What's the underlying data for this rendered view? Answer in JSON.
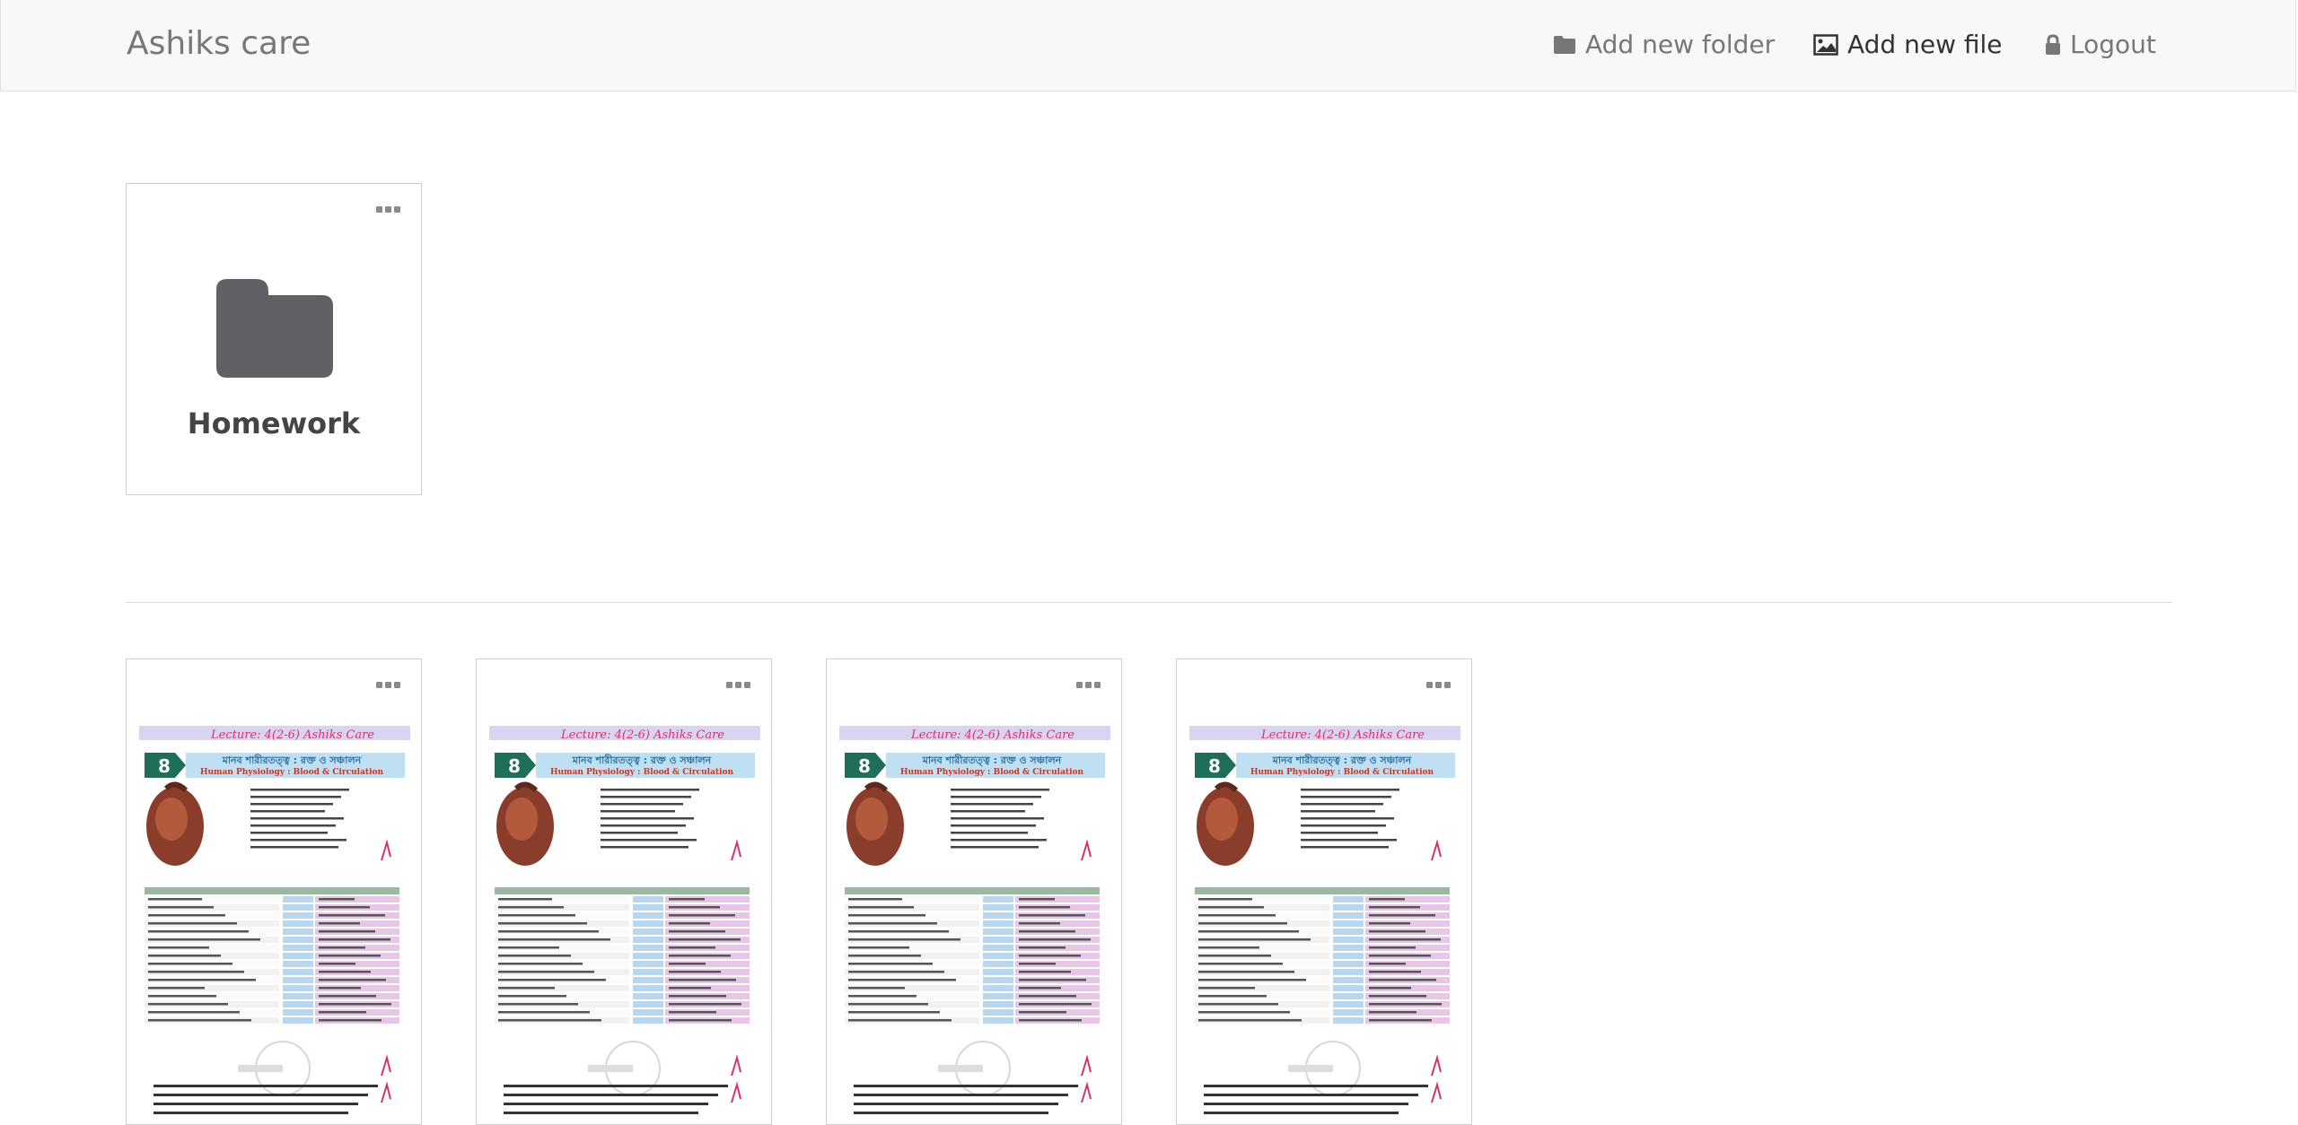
{
  "navbar": {
    "brand": "Ashiks care",
    "add_folder_label": "Add new folder",
    "add_file_label": "Add new file",
    "logout_label": "Logout"
  },
  "folders": [
    {
      "name": "Homework"
    }
  ],
  "files": [
    {
      "thumb_header": "Lecture: 4(2-6) Ashiks Care",
      "chapter_no": "8",
      "title_bn": "মানব শারীরতত্ত্ব : রক্ত ও সঞ্চালন",
      "title_en": "Human Physiology : Blood & Circulation"
    },
    {
      "thumb_header": "Lecture: 4(2-6) Ashiks Care",
      "chapter_no": "8",
      "title_bn": "মানব শারীরতত্ত্ব : রক্ত ও সঞ্চালন",
      "title_en": "Human Physiology : Blood & Circulation"
    },
    {
      "thumb_header": "Lecture: 4(2-6) Ashiks Care",
      "chapter_no": "8",
      "title_bn": "মানব শারীরতত্ত্ব : রক্ত ও সঞ্চালন",
      "title_en": "Human Physiology : Blood & Circulation"
    },
    {
      "thumb_header": "Lecture: 4(2-6) Ashiks Care",
      "chapter_no": "8",
      "title_bn": "মানব শারীরতত্ত্ব : রক্ত ও সঞ্চালন",
      "title_en": "Human Physiology : Blood & Circulation"
    }
  ],
  "colors": {
    "folder_icon": "#5f6166",
    "navbar_bg": "#f8f8f8",
    "nav_text": "#777777",
    "thumb_banner": "#2e6f9e",
    "thumb_pink": "#e7c6e8",
    "thumb_blue": "#b8d6ee",
    "handwriting": "#d6336c"
  }
}
